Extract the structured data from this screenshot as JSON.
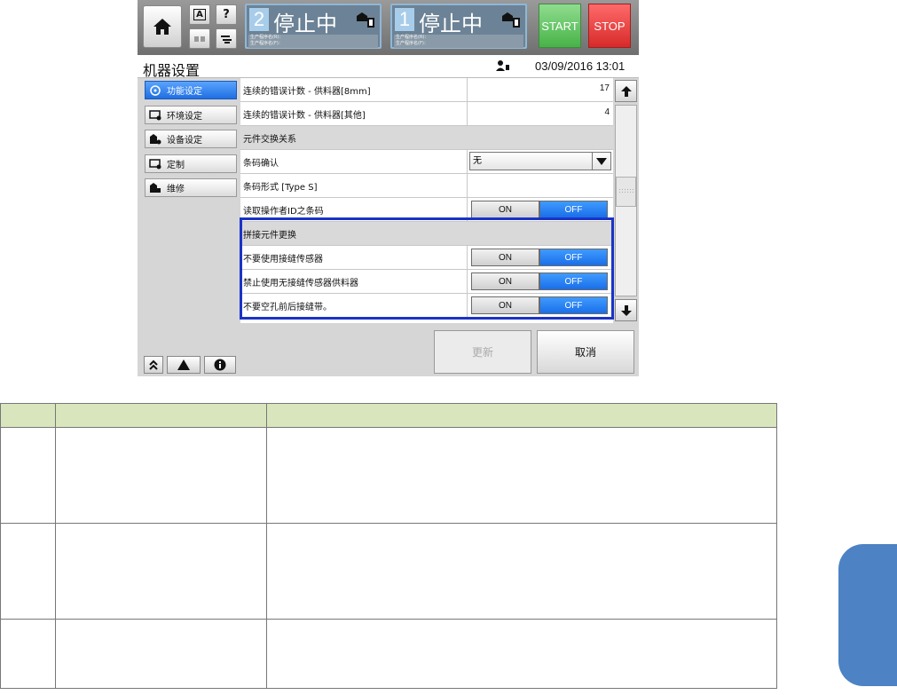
{
  "header": {
    "lane2": {
      "number": "2",
      "status": "停止中",
      "info_line1": "生产程序名(R)：",
      "info_line2": "生产程序名(F)："
    },
    "lane1": {
      "number": "1",
      "status": "停止中",
      "info_line1": "生产程序名(R)：",
      "info_line2": "生产程序名(F)："
    },
    "start_label": "START",
    "stop_label": "STOP",
    "small_buttons": {
      "a_label": "A",
      "help_label": "?"
    }
  },
  "titlebar": {
    "title": "机器设置",
    "datetime": "03/09/2016 13:01"
  },
  "sidebar": {
    "items": [
      {
        "label": "功能设定",
        "active": true
      },
      {
        "label": "环境设定",
        "active": false
      },
      {
        "label": "设备设定",
        "active": false
      },
      {
        "label": "定制",
        "active": false
      },
      {
        "label": "维修",
        "active": false
      }
    ]
  },
  "rows": [
    {
      "type": "value",
      "label": "连续的错误计数 - 供料器[8mm]",
      "value": "17"
    },
    {
      "type": "value",
      "label": "连续的错误计数 - 供料器[其他]",
      "value": "4"
    },
    {
      "type": "section",
      "label": "元件交换关系"
    },
    {
      "type": "dropdown",
      "label": "条码确认",
      "value": "无"
    },
    {
      "type": "value",
      "label": "条码形式 [Type S]",
      "value": ""
    },
    {
      "type": "toggle",
      "label": "读取操作者ID之条码",
      "on_label": "ON",
      "off_label": "OFF",
      "state": "OFF"
    },
    {
      "type": "section",
      "label": "拼接元件更换"
    },
    {
      "type": "toggle",
      "label": "不要使用接缝传感器",
      "on_label": "ON",
      "off_label": "OFF",
      "state": "OFF"
    },
    {
      "type": "toggle",
      "label": "禁止使用无接缝传感器供料器",
      "on_label": "ON",
      "off_label": "OFF",
      "state": "OFF"
    },
    {
      "type": "toggle",
      "label": "不要空孔前后接缝带。",
      "on_label": "ON",
      "off_label": "OFF",
      "state": "OFF"
    }
  ],
  "footer": {
    "update_label": "更新",
    "cancel_label": "取消"
  },
  "colors": {
    "active_blue": "#1f6fe0",
    "highlight": "#1a33c7",
    "start_green": "#47b347",
    "stop_red": "#d72a2a",
    "table_header": "#d9e6bd",
    "side_tab": "#4d82c4"
  }
}
